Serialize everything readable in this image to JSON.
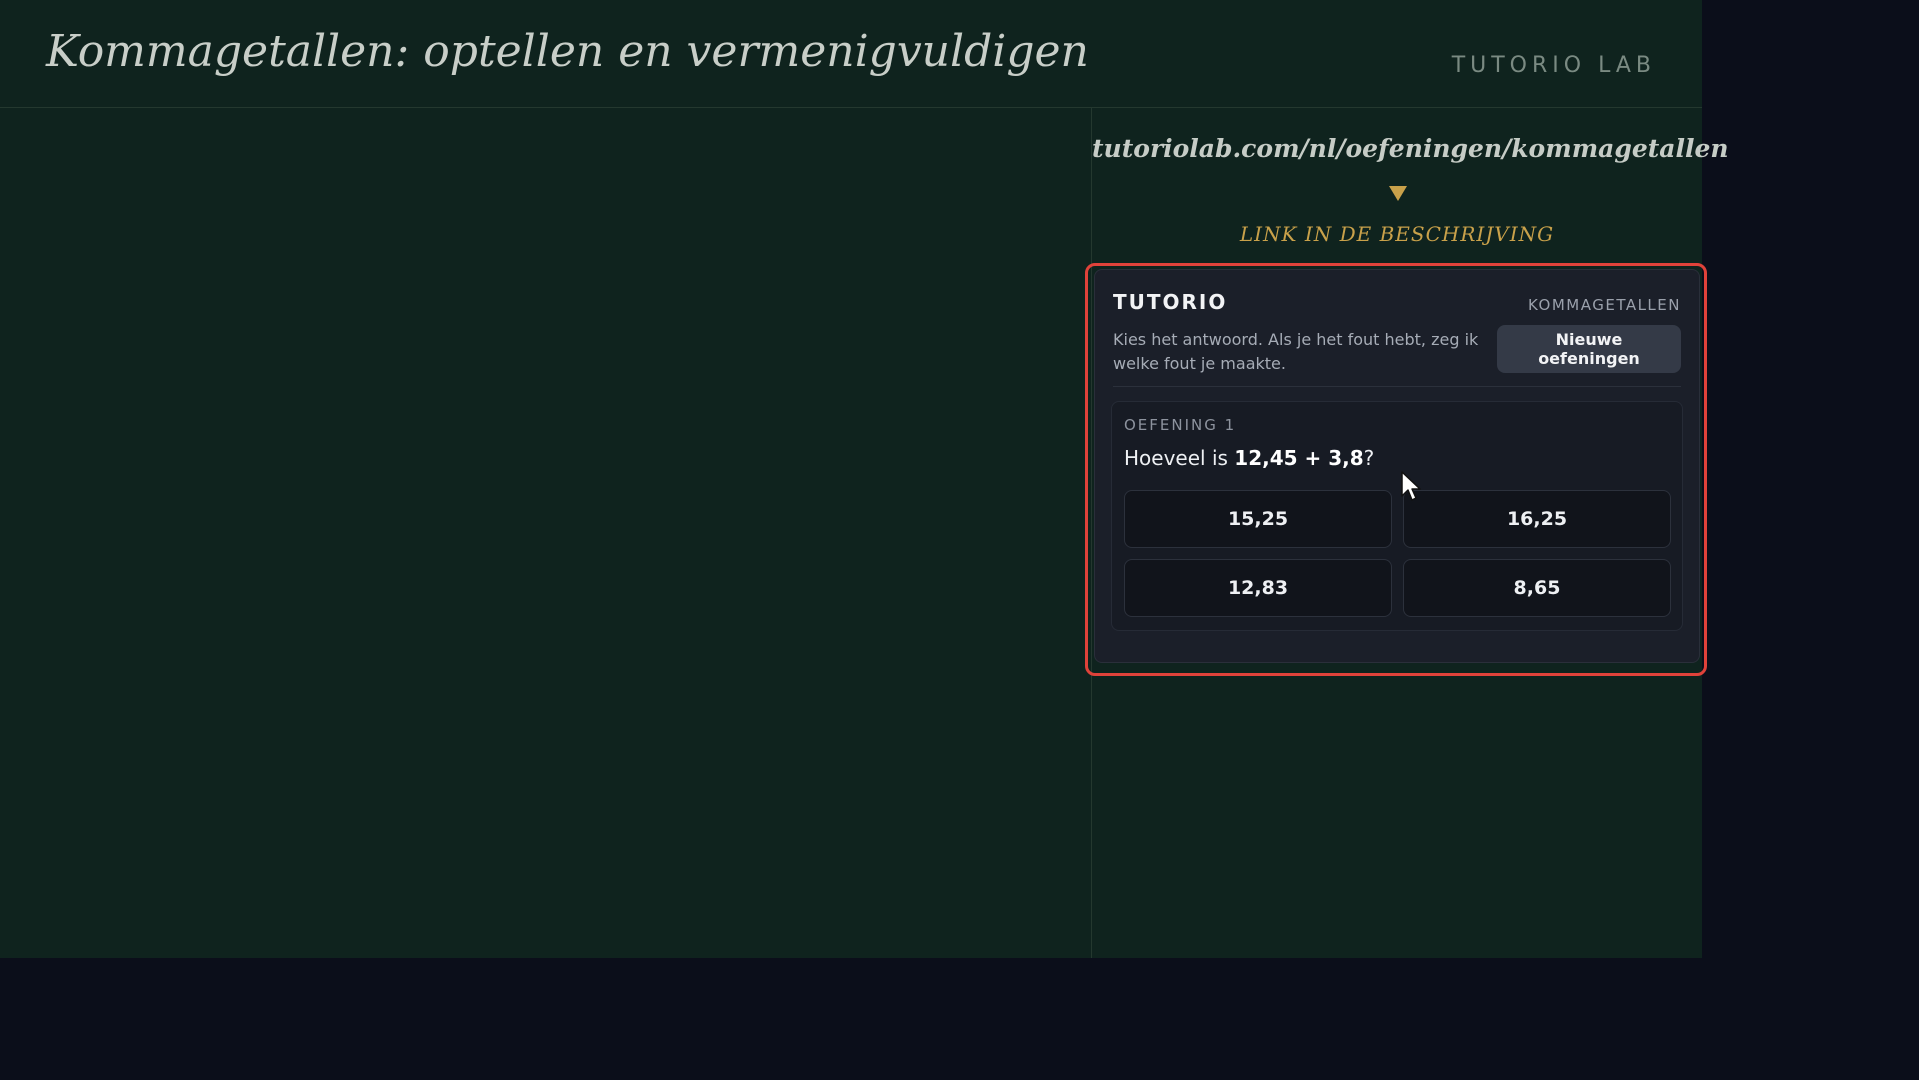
{
  "header": {
    "title": "Kommagetallen: optellen en vermenigvuldigen",
    "brand": "TUTORIO LAB"
  },
  "promo": {
    "url": "tutoriolab.com/nl/oefeningen/kommagetallen",
    "arrow_icon": "arrow-down-icon",
    "caption": "LINK IN DE BESCHRIJVING"
  },
  "widget": {
    "brand": "TUTORIO",
    "topic": "KOMMAGETALLEN",
    "instructions": "Kies het antwoord. Als je het fout hebt, zeg ik welke fout je maakte.",
    "new_button_label": "Nieuwe oefeningen",
    "exercise": {
      "label": "OEFENING 1",
      "question_prefix": "Hoeveel is ",
      "question_expression": "12,45 + 3,8",
      "question_suffix": "?",
      "answers": [
        "15,25",
        "16,25",
        "12,83",
        "8,65"
      ]
    }
  },
  "colors": {
    "board": "#0f231e",
    "outer": "#0b0e1a",
    "accent_gold": "#c9a14a",
    "highlight_red": "#e0423a",
    "widget_bg": "#1b1f29"
  },
  "cursor_icon": "mouse-pointer-icon"
}
